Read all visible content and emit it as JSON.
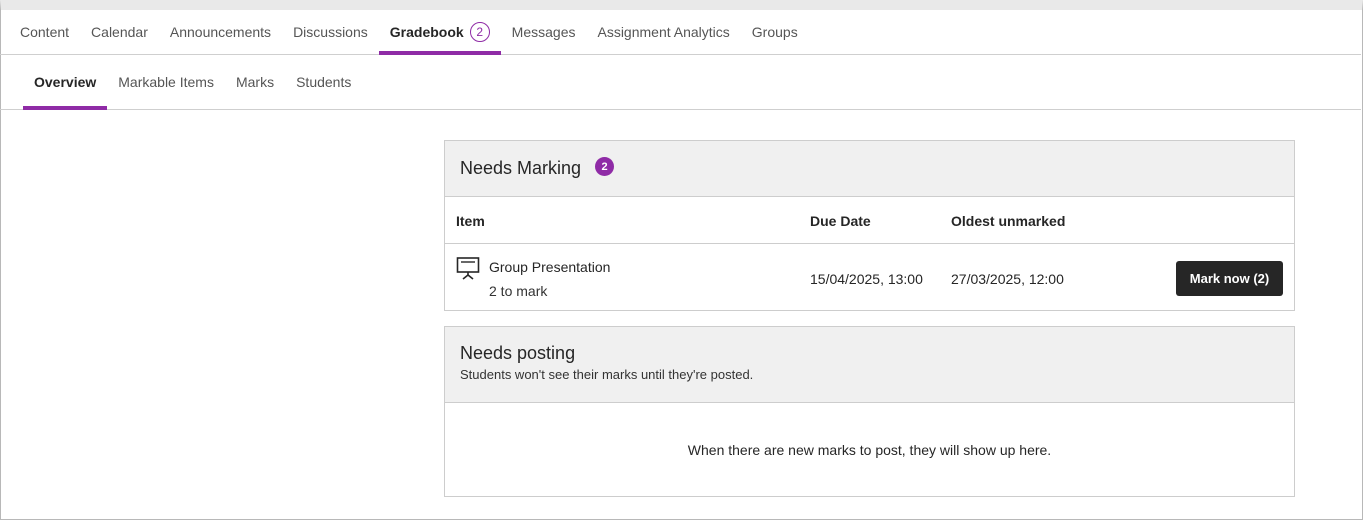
{
  "primary_nav": [
    {
      "label": "Content"
    },
    {
      "label": "Calendar"
    },
    {
      "label": "Announcements"
    },
    {
      "label": "Discussions"
    },
    {
      "label": "Gradebook",
      "badge": "2",
      "active": true
    },
    {
      "label": "Messages"
    },
    {
      "label": "Assignment Analytics"
    },
    {
      "label": "Groups"
    }
  ],
  "secondary_nav": [
    {
      "label": "Overview",
      "active": true
    },
    {
      "label": "Markable Items"
    },
    {
      "label": "Marks"
    },
    {
      "label": "Students"
    }
  ],
  "needs_marking": {
    "title": "Needs Marking",
    "count": "2",
    "columns": {
      "item": "Item",
      "due_date": "Due Date",
      "oldest_unmarked": "Oldest unmarked"
    },
    "rows": [
      {
        "icon": "presentation-icon",
        "name": "Group Presentation",
        "to_mark": "2 to mark",
        "due_date": "15/04/2025, 13:00",
        "oldest_unmarked": "27/03/2025, 12:00",
        "action_label": "Mark now (2)"
      }
    ]
  },
  "needs_posting": {
    "title": "Needs posting",
    "description": "Students won't see their marks until they're posted.",
    "empty_message": "When there are new marks to post, they will show up here."
  },
  "colors": {
    "accent": "#8f2ba6",
    "button": "#262626",
    "panel_header": "#f0f0f0"
  }
}
